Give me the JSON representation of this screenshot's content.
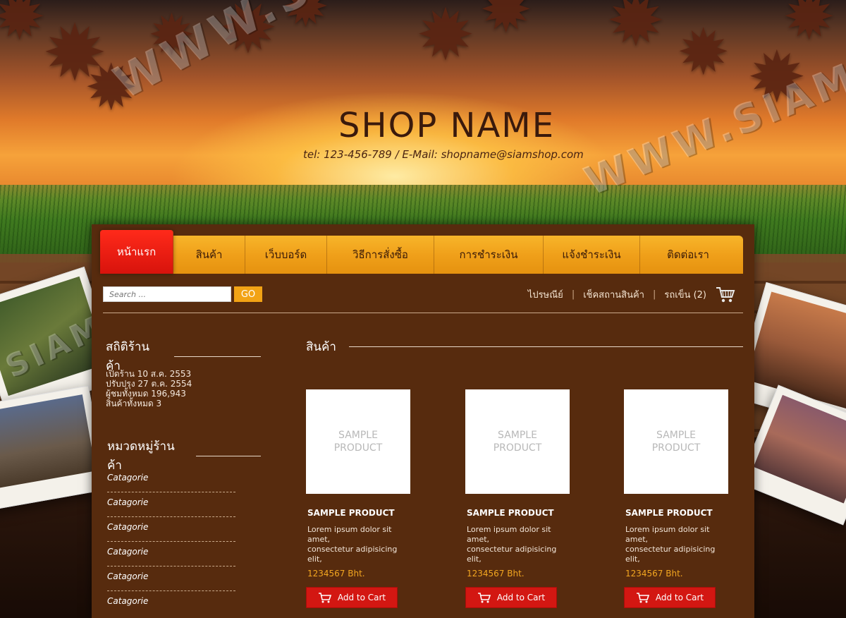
{
  "header": {
    "shop_name": "SHOP NAME",
    "contact": "tel: 123-456-789  /  E-Mail: shopname@siamshop.com",
    "watermark_1": "WWW.SIAMSHO",
    "watermark_2": "WWW.SIAM",
    "watermark_3": "SIAMSHOP.COM"
  },
  "nav": {
    "items": [
      {
        "label": "หน้าแรก"
      },
      {
        "label": "สินค้า"
      },
      {
        "label": "เว็บบอร์ด"
      },
      {
        "label": "วิธีการสั่งซื้อ"
      },
      {
        "label": "การชำระเงิน"
      },
      {
        "label": "แจ้งชำระเงิน"
      },
      {
        "label": "ติดต่อเรา"
      }
    ]
  },
  "search": {
    "placeholder": "Search ...",
    "go_label": "GO"
  },
  "toplinks": {
    "post": "ไปรษณีย์",
    "check_status": "เช็คสถานสินค้า",
    "cart": "รถเข็น (2)"
  },
  "stats": {
    "title": "สถิติร้านค้า",
    "lines": [
      "เปิดร้าน 10 ส.ค. 2553",
      "ปรับปรุง 27 ต.ค. 2554",
      "ผู้ชมทั้งหมด 196,943",
      "สินค้าทั้งหมด 3"
    ]
  },
  "categories": {
    "title": "หมวดหมู่ร้านค้า",
    "items": [
      "Catagorie",
      "Catagorie",
      "Catagorie",
      "Catagorie",
      "Catagorie",
      "Catagorie"
    ]
  },
  "products": {
    "title": "สินค้า",
    "items": [
      {
        "thumb_line1": "SAMPLE",
        "thumb_line2": "PRODUCT",
        "name": "SAMPLE PRODUCT",
        "desc1": "Lorem ipsum dolor sit amet,",
        "desc2": "consectetur adipisicing elit,",
        "price": "1234567 Bht.",
        "button": "Add to Cart"
      },
      {
        "thumb_line1": "SAMPLE",
        "thumb_line2": "PRODUCT",
        "name": "SAMPLE PRODUCT",
        "desc1": "Lorem ipsum dolor sit amet,",
        "desc2": "consectetur adipisicing elit,",
        "price": "1234567 Bht.",
        "button": "Add to Cart"
      },
      {
        "thumb_line1": "SAMPLE",
        "thumb_line2": "PRODUCT",
        "name": "SAMPLE PRODUCT",
        "desc1": "Lorem ipsum dolor sit amet,",
        "desc2": "consectetur adipisicing elit,",
        "price": "1234567 Bht.",
        "button": "Add to Cart"
      }
    ]
  },
  "colors": {
    "panel_bg": "#572b0e",
    "nav_orange": "#f0a01a",
    "active_red": "#d8130c",
    "price_orange": "#f3a620",
    "button_red": "#d31712"
  }
}
